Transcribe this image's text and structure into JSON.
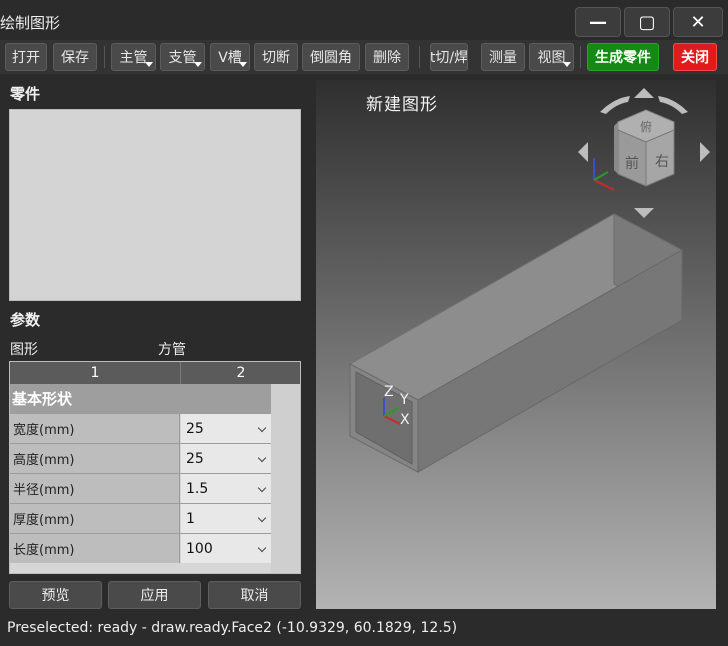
{
  "window": {
    "title": "绘制图形",
    "min_glyph": "—",
    "max_glyph": "▢",
    "close_glyph": "✕"
  },
  "toolbar": {
    "open": "打开",
    "save": "保存",
    "main_pipe": "主管",
    "branch_pipe": "支管",
    "v_groove": "V槽",
    "cut_off": "切断",
    "fillet": "倒圆角",
    "delete": "删除",
    "cut_weld": "t切/焊",
    "measure": "测量",
    "view": "视图",
    "generate_part": "生成零件",
    "close": "关闭"
  },
  "left_panel": {
    "parts_title": "零件",
    "params_title": "参数",
    "shape_label": "图形",
    "shape_value": "方管"
  },
  "grid": {
    "headers": [
      "1",
      "2"
    ],
    "group": "基本形状",
    "rows": [
      {
        "name": "宽度(mm)",
        "value": "25"
      },
      {
        "name": "高度(mm)",
        "value": "25"
      },
      {
        "name": "半径(mm)",
        "value": "1.5"
      },
      {
        "name": "厚度(mm)",
        "value": "1"
      },
      {
        "name": "长度(mm)",
        "value": "100"
      }
    ]
  },
  "buttons": {
    "preview": "预览",
    "apply": "应用",
    "cancel": "取消"
  },
  "viewport": {
    "title": "新建图形",
    "cube_faces": {
      "top": "俯",
      "front": "前",
      "right": "右"
    },
    "axes": {
      "z": "Z",
      "y": "Y",
      "x": "X"
    }
  },
  "status": {
    "text": "Preselected: ready - draw.ready.Face2 (-10.9329, 60.1829, 12.5)"
  },
  "colors": {
    "generate_green": "#138a13",
    "close_red": "#e01b1b"
  }
}
